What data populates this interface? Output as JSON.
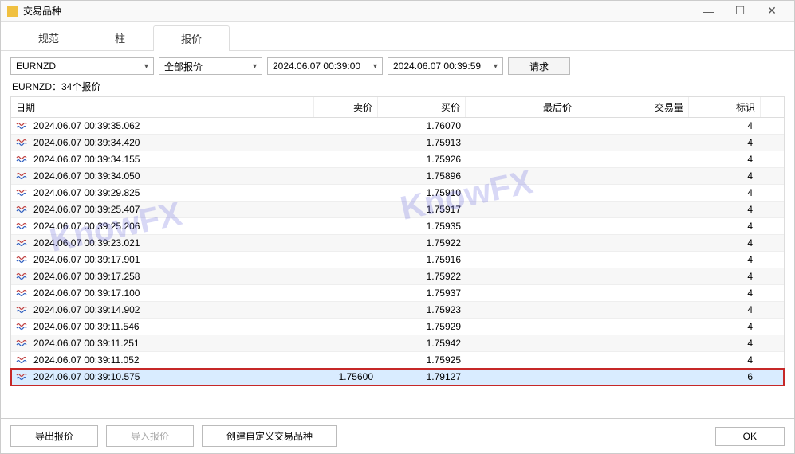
{
  "window": {
    "title": "交易品种"
  },
  "tabs": {
    "spec": "规范",
    "bar": "柱",
    "quote": "报价"
  },
  "filters": {
    "symbol": "EURNZD",
    "quoteType": "全部报价",
    "dtFrom": "2024.06.07 00:39:00",
    "dtTo": "2024.06.07 00:39:59",
    "request": "请求"
  },
  "subtitle": "EURNZD：34个报价",
  "columns": {
    "date": "日期",
    "sell": "卖价",
    "buy": "买价",
    "last": "最后价",
    "vol": "交易量",
    "flag": "标识"
  },
  "rows": [
    {
      "date": "2024.06.07 00:39:35.062",
      "sell": "",
      "buy": "1.76070",
      "last": "",
      "vol": "",
      "flag": "4",
      "alt": false,
      "hl": false
    },
    {
      "date": "2024.06.07 00:39:34.420",
      "sell": "",
      "buy": "1.75913",
      "last": "",
      "vol": "",
      "flag": "4",
      "alt": true,
      "hl": false
    },
    {
      "date": "2024.06.07 00:39:34.155",
      "sell": "",
      "buy": "1.75926",
      "last": "",
      "vol": "",
      "flag": "4",
      "alt": false,
      "hl": false
    },
    {
      "date": "2024.06.07 00:39:34.050",
      "sell": "",
      "buy": "1.75896",
      "last": "",
      "vol": "",
      "flag": "4",
      "alt": true,
      "hl": false
    },
    {
      "date": "2024.06.07 00:39:29.825",
      "sell": "",
      "buy": "1.75910",
      "last": "",
      "vol": "",
      "flag": "4",
      "alt": false,
      "hl": false
    },
    {
      "date": "2024.06.07 00:39:25.407",
      "sell": "",
      "buy": "1.75917",
      "last": "",
      "vol": "",
      "flag": "4",
      "alt": true,
      "hl": false
    },
    {
      "date": "2024.06.07 00:39:25.206",
      "sell": "",
      "buy": "1.75935",
      "last": "",
      "vol": "",
      "flag": "4",
      "alt": false,
      "hl": false
    },
    {
      "date": "2024.06.07 00:39:23.021",
      "sell": "",
      "buy": "1.75922",
      "last": "",
      "vol": "",
      "flag": "4",
      "alt": true,
      "hl": false
    },
    {
      "date": "2024.06.07 00:39:17.901",
      "sell": "",
      "buy": "1.75916",
      "last": "",
      "vol": "",
      "flag": "4",
      "alt": false,
      "hl": false
    },
    {
      "date": "2024.06.07 00:39:17.258",
      "sell": "",
      "buy": "1.75922",
      "last": "",
      "vol": "",
      "flag": "4",
      "alt": true,
      "hl": false
    },
    {
      "date": "2024.06.07 00:39:17.100",
      "sell": "",
      "buy": "1.75937",
      "last": "",
      "vol": "",
      "flag": "4",
      "alt": false,
      "hl": false
    },
    {
      "date": "2024.06.07 00:39:14.902",
      "sell": "",
      "buy": "1.75923",
      "last": "",
      "vol": "",
      "flag": "4",
      "alt": true,
      "hl": false
    },
    {
      "date": "2024.06.07 00:39:11.546",
      "sell": "",
      "buy": "1.75929",
      "last": "",
      "vol": "",
      "flag": "4",
      "alt": false,
      "hl": false
    },
    {
      "date": "2024.06.07 00:39:11.251",
      "sell": "",
      "buy": "1.75942",
      "last": "",
      "vol": "",
      "flag": "4",
      "alt": true,
      "hl": false
    },
    {
      "date": "2024.06.07 00:39:11.052",
      "sell": "",
      "buy": "1.75925",
      "last": "",
      "vol": "",
      "flag": "4",
      "alt": false,
      "hl": false
    },
    {
      "date": "2024.06.07 00:39:10.575",
      "sell": "1.75600",
      "buy": "1.79127",
      "last": "",
      "vol": "",
      "flag": "6",
      "alt": true,
      "hl": true
    }
  ],
  "footer": {
    "export": "导出报价",
    "import": "导入报价",
    "custom": "创建自定义交易品种",
    "ok": "OK"
  },
  "watermark": "KnowFX"
}
